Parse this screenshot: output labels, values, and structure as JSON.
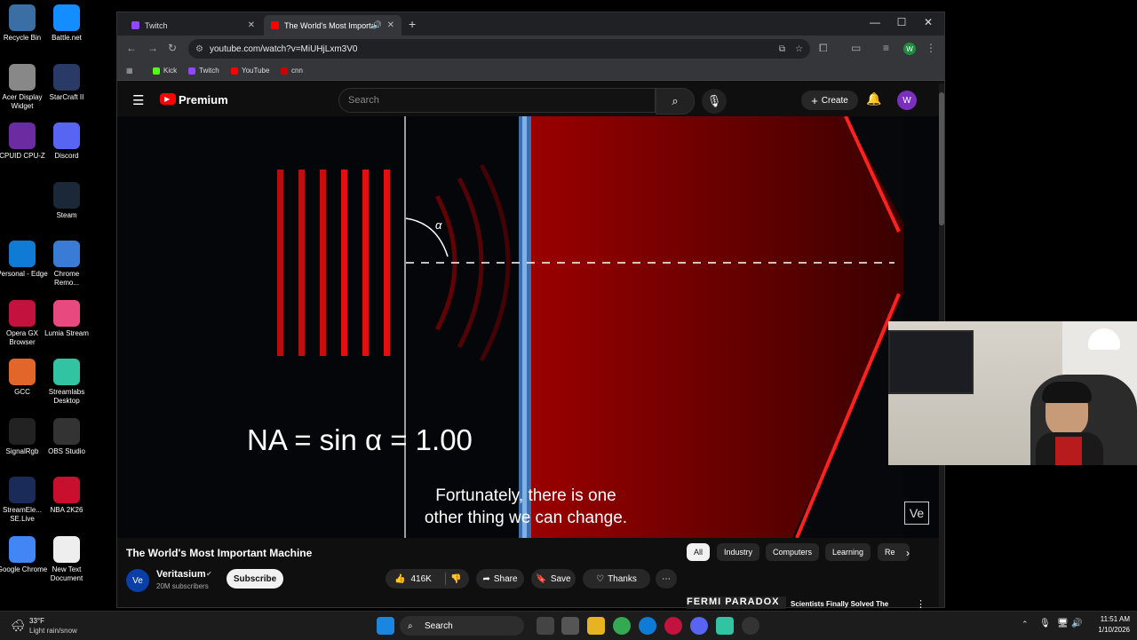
{
  "desktop_icons": [
    {
      "label": "Recycle Bin",
      "color": "#3b6ea5"
    },
    {
      "label": "Battle.net",
      "color": "#148eff"
    },
    {
      "label": "Acer Display Widget",
      "color": "#888"
    },
    {
      "label": "StarCraft II",
      "color": "#2a3a66"
    },
    {
      "label": "CPUID CPU-Z",
      "color": "#6a2ca0"
    },
    {
      "label": "Discord",
      "color": "#5865f2"
    },
    {
      "label": "Steam",
      "color": "#1b2838"
    },
    {
      "label": "Personal - Edge",
      "color": "#0f7bd4"
    },
    {
      "label": "Chrome Remo...",
      "color": "#3a7bd5"
    },
    {
      "label": "Opera GX Browser",
      "color": "#c2123d"
    },
    {
      "label": "Lumia Stream",
      "color": "#e84a7f"
    },
    {
      "label": "GCC",
      "color": "#e2662a"
    },
    {
      "label": "Streamlabs Desktop",
      "color": "#31c3a2"
    },
    {
      "label": "SignalRgb",
      "color": "#222"
    },
    {
      "label": "OBS Studio",
      "color": "#333"
    },
    {
      "label": "StreamEle... SE.Live",
      "color": "#1a2b5a"
    },
    {
      "label": "NBA 2K26",
      "color": "#c8102e"
    },
    {
      "label": "Google Chrome",
      "color": "#4285f4"
    },
    {
      "label": "New Text Document",
      "color": "#eee"
    }
  ],
  "browser": {
    "tabs": [
      {
        "title": "Twitch",
        "color": "#9146ff"
      },
      {
        "title": "The World's Most Importan",
        "color": "#ff0000"
      }
    ],
    "url": "youtube.com/watch?v=MiUHjLxm3V0",
    "bookmarks": [
      {
        "label": "Kick",
        "color": "#53fc18"
      },
      {
        "label": "Twitch",
        "color": "#9146ff"
      },
      {
        "label": "YouTube",
        "color": "#ff0000"
      },
      {
        "label": "cnn",
        "color": "#cc0000"
      }
    ],
    "profile_initial": "W"
  },
  "youtube": {
    "logo": "Premium",
    "search_placeholder": "Search",
    "create_label": "Create",
    "avatar_initial": "W",
    "video": {
      "formula": "NA = sin α = 1.00",
      "alpha_label": "α",
      "subtitle_line1": "Fortunately, there is one",
      "subtitle_line2": "other thing we can change.",
      "watermark": "Ve"
    },
    "title": "The World's Most Important Machine",
    "channel": "Veritasium",
    "channel_avatar": "Ve",
    "subscribers": "20M subscribers",
    "subscribe_label": "Subscribe",
    "likes": "416K",
    "share_label": "Share",
    "save_label": "Save",
    "thanks_label": "Thanks",
    "chips": [
      "All",
      "Industry",
      "Computers",
      "Learning",
      "Re"
    ],
    "recommended": {
      "thumb_text": "FERMI PARADOX",
      "title": "Scientists Finally Solved The Fermi Paradox - And It's Scary"
    }
  },
  "taskbar": {
    "weather_temp": "33°F",
    "weather_desc": "Light rain/snow",
    "search_label": "Search",
    "time": "11:51 AM",
    "date": "1/10/2026"
  }
}
